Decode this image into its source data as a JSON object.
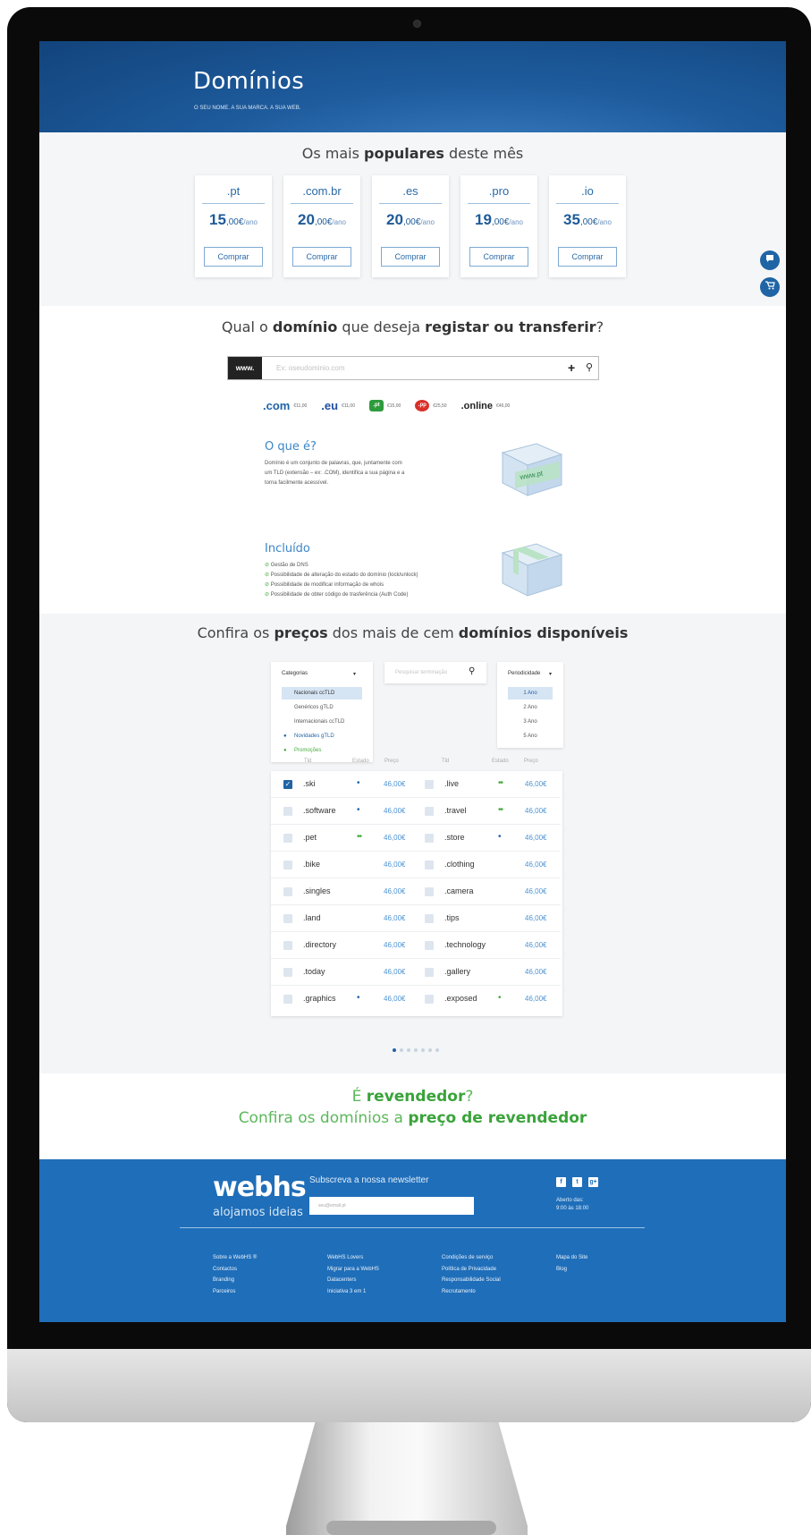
{
  "hero": {
    "title": "Domínios",
    "subtitle": "O SEU NOME. A SUA MARCA. A SUA WEB."
  },
  "popular": {
    "title_pre": "Os mais ",
    "title_bold": "populares",
    "title_post": " deste mês",
    "cards": [
      {
        "ext": ".pt",
        "price_int": "15",
        "price_dec": ",00€",
        "unit": "/ano",
        "button": "Comprar"
      },
      {
        "ext": ".com.br",
        "price_int": "20",
        "price_dec": ",00€",
        "unit": "/ano",
        "button": "Comprar"
      },
      {
        "ext": ".es",
        "price_int": "20",
        "price_dec": ",00€",
        "unit": "/ano",
        "button": "Comprar"
      },
      {
        "ext": ".pro",
        "price_int": "19",
        "price_dec": ",00€",
        "unit": "/ano",
        "button": "Comprar"
      },
      {
        "ext": ".io",
        "price_int": "35",
        "price_dec": ",00€",
        "unit": "/ano",
        "button": "Comprar"
      }
    ]
  },
  "float_buttons": {
    "chat_icon": "chat-icon",
    "cart_icon": "cart-icon"
  },
  "search": {
    "title_1": "Qual o ",
    "title_2": "domínio",
    "title_3": " que deseja ",
    "title_4": "registar ou transferir",
    "title_5": "?",
    "prefix": "www.",
    "placeholder": "Ex: oseudominio.com",
    "tlds": [
      {
        "name": ".com",
        "price": "€11,00"
      },
      {
        "name": ".eu",
        "price": "€11,00"
      },
      {
        "name": ".pt",
        "price": "€15,00"
      },
      {
        "name": ".pp",
        "price": "€25,50"
      },
      {
        "name": ".online",
        "price": "€46,00"
      }
    ],
    "what_title": "O que é?",
    "what_text_1": "Domínio é um conjunto de palavras, que, juntamente com",
    "what_text_2": "um TLD (extensão – ex: .COM), identifica a sua página e a",
    "what_text_3": "torna facilmente acessível.",
    "box_label": "www.pt",
    "included_title": "Incluído",
    "included": [
      "Gestão de DNS",
      "Possibilidade de alteração do estado do domínio (lock/unlock)",
      "Possibilidade de modificar informação de whois",
      "Possibilidade de obter código de trasferência (Auth Code)"
    ]
  },
  "prices": {
    "title_1": "Confira os ",
    "title_2": "preços",
    "title_3": " dos mais de cem ",
    "title_4": "domínios disponíveis",
    "categories_label": "Categorias",
    "categories": [
      "Nacionais ccTLD",
      "Genéricos gTLD",
      "Internacionais ccTLD",
      "Novidades gTLD",
      "Promoções"
    ],
    "search_placeholder": "Pesquisar terminação",
    "period_label": "Periodicidade",
    "periods": [
      "1 Ano",
      "2 Ano",
      "3 Ano",
      "5 Ano"
    ],
    "headers": [
      "Tld",
      "Estado",
      "Preço",
      "Tld",
      "Estado",
      "Preço"
    ],
    "left": [
      {
        "tld": ".ski",
        "state": "•",
        "price": "46,00€"
      },
      {
        "tld": ".software",
        "state": "•",
        "price": "46,00€"
      },
      {
        "tld": ".pet",
        "state": "••",
        "price": "46,00€"
      },
      {
        "tld": ".bike",
        "state": "",
        "price": "46,00€"
      },
      {
        "tld": ".singles",
        "state": "",
        "price": "46,00€"
      },
      {
        "tld": ".land",
        "state": "",
        "price": "46,00€"
      },
      {
        "tld": ".directory",
        "state": "",
        "price": "46,00€"
      },
      {
        "tld": ".today",
        "state": "",
        "price": "46,00€"
      },
      {
        "tld": ".graphics",
        "state": "•",
        "price": "46,00€"
      }
    ],
    "right": [
      {
        "tld": ".live",
        "state": "••",
        "price": "46,00€"
      },
      {
        "tld": ".travel",
        "state": "••",
        "price": "46,00€"
      },
      {
        "tld": ".store",
        "state": "•",
        "price": "46,00€"
      },
      {
        "tld": ".clothing",
        "state": "",
        "price": "46,00€"
      },
      {
        "tld": ".camera",
        "state": "",
        "price": "46,00€"
      },
      {
        "tld": ".tips",
        "state": "",
        "price": "46,00€"
      },
      {
        "tld": ".technology",
        "state": "",
        "price": "46,00€"
      },
      {
        "tld": ".gallery",
        "state": "",
        "price": "46,00€"
      },
      {
        "tld": ".exposed",
        "state": "•",
        "price": "46,00€"
      }
    ]
  },
  "reseller": {
    "l1_a": "É ",
    "l1_b": "revendedor",
    "l1_c": "?",
    "l2_a": "Confira os domínios a ",
    "l2_b": "preço de revendedor"
  },
  "footer": {
    "logo": "webhs",
    "slogan": "alojamos ideias",
    "newsletter_label": "Subscreva a nossa newsletter",
    "newsletter_placeholder": "seu@email.pt",
    "hours_1": "Aberto das:",
    "hours_2": "9:00 às 18:00",
    "social": [
      "f",
      "t",
      "g+"
    ],
    "col1": [
      "Sobre a WebHS ®",
      "Contactos",
      "Branding",
      "Parceiros"
    ],
    "col2": [
      "WebHS Lovers",
      "Migrar para a WebHS",
      "Datacenters",
      "Iniciativa 3 em 1"
    ],
    "col3": [
      "Condições de serviço",
      "Política de Privacidade",
      "Responsabilidade Social",
      "Recrutamento"
    ],
    "col4": [
      "Mapa do Site",
      "Blog"
    ]
  }
}
